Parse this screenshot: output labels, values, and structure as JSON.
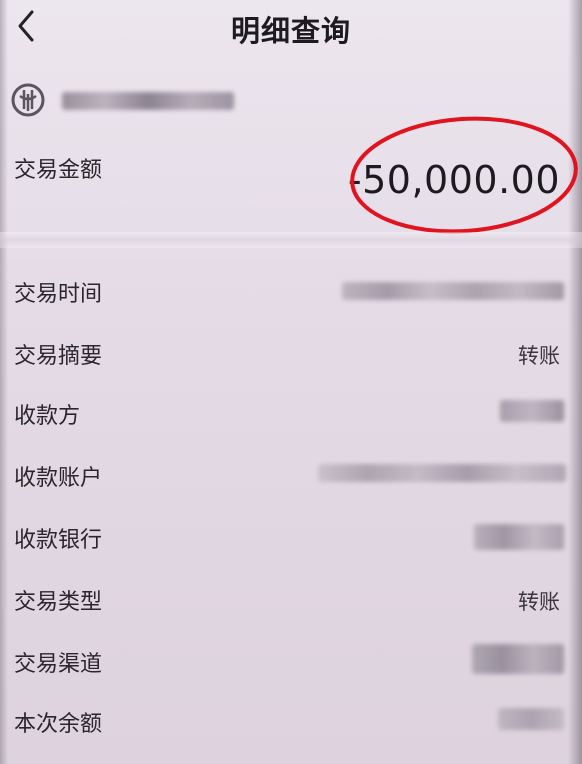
{
  "header": {
    "title": "明细查询",
    "back_icon": "chevron-left-icon"
  },
  "bank": {
    "logo_icon": "abc-bank-logo-icon",
    "name_redacted": true
  },
  "amount": {
    "label": "交易金额",
    "value": "-50,000.00",
    "highlight_color": "#e0141f"
  },
  "details": [
    {
      "label": "交易时间",
      "value": "",
      "redacted": true
    },
    {
      "label": "交易摘要",
      "value": "转账",
      "redacted": false
    },
    {
      "label": "收款方",
      "value": "",
      "redacted": true
    },
    {
      "label": "收款账户",
      "value": "",
      "redacted": true
    },
    {
      "label": "收款银行",
      "value": "",
      "redacted": true
    },
    {
      "label": "交易类型",
      "value": "转账",
      "redacted": false
    },
    {
      "label": "交易渠道",
      "value": "",
      "redacted": true
    },
    {
      "label": "本次余额",
      "value": "",
      "redacted": true
    }
  ]
}
